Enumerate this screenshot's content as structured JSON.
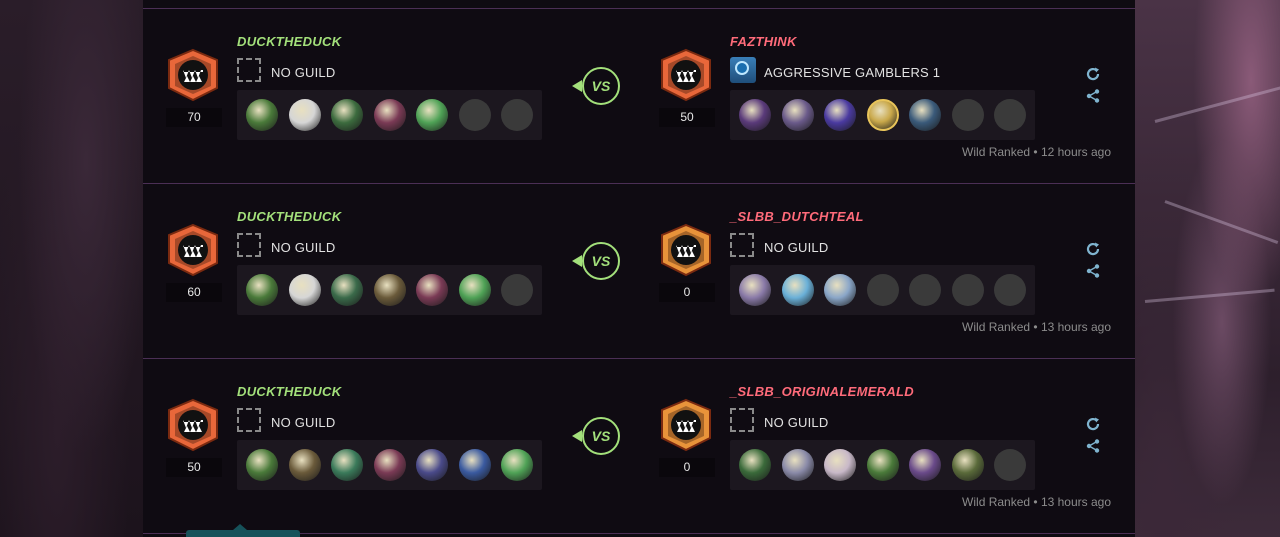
{
  "battles": [
    {
      "player": {
        "name": "DUCKTHEDUCK",
        "rating": "70",
        "guild": "NO GUILD",
        "team": [
          "#4a7a3a",
          "#d6d6d6",
          "#3c6b3e",
          "#7a3a55",
          "#4fa256",
          "empty",
          "empty"
        ]
      },
      "vs_label": "VS",
      "opponent": {
        "name": "FAZTHINK",
        "rating": "50",
        "guild": "AGGRESSIVE GAMBLERS 1",
        "has_guild_flag": true,
        "team": [
          "#5a3a7a",
          "#6a5a8a",
          "#4a3aa0",
          "#c9a84a",
          "#3a5a7a",
          "empty",
          "empty"
        ]
      },
      "meta": "Wild Ranked • 12 hours ago"
    },
    {
      "player": {
        "name": "DUCKTHEDUCK",
        "rating": "60",
        "guild": "NO GUILD",
        "team": [
          "#4a7a3a",
          "#d6d6d6",
          "#3a6a4a",
          "#6a5a3a",
          "#7a3a55",
          "#4fa256",
          "empty"
        ]
      },
      "vs_label": "VS",
      "opponent": {
        "name": "_SLBB_DUTCHTEAL",
        "rating": "0",
        "guild": "NO GUILD",
        "has_guild_flag": false,
        "team": [
          "#8a7aa8",
          "#6ab0d8",
          "#8aa6c8",
          "empty",
          "empty",
          "empty",
          "empty"
        ]
      },
      "meta": "Wild Ranked • 13 hours ago"
    },
    {
      "player": {
        "name": "DUCKTHEDUCK",
        "rating": "50",
        "guild": "NO GUILD",
        "team": [
          "#4a7a3a",
          "#6a5a3a",
          "#3a7a5a",
          "#7a3a55",
          "#4a4a8a",
          "#3a5aa0",
          "#4fa256"
        ]
      },
      "vs_label": "VS",
      "opponent": {
        "name": "_SLBB_ORIGINALEMERALD",
        "rating": "0",
        "guild": "NO GUILD",
        "has_guild_flag": false,
        "team": [
          "#3a6a3a",
          "#8a8aa8",
          "#c8b8c8",
          "#4a7a3a",
          "#6a4a8a",
          "#5a6a3a",
          "empty"
        ]
      },
      "meta": "Wild Ranked • 13 hours ago"
    }
  ],
  "colors": {
    "player_name": "#a3e07b",
    "opponent_name": "#ff6b7a",
    "badge_player": "#e8673a",
    "badge_opponent": "#e8933a",
    "accent": "#16525a"
  },
  "icons": {
    "refresh": "refresh-icon",
    "share": "share-icon",
    "rank_badge": "monster-mouth-badge-icon",
    "no_guild": "dashed-banner-icon"
  }
}
